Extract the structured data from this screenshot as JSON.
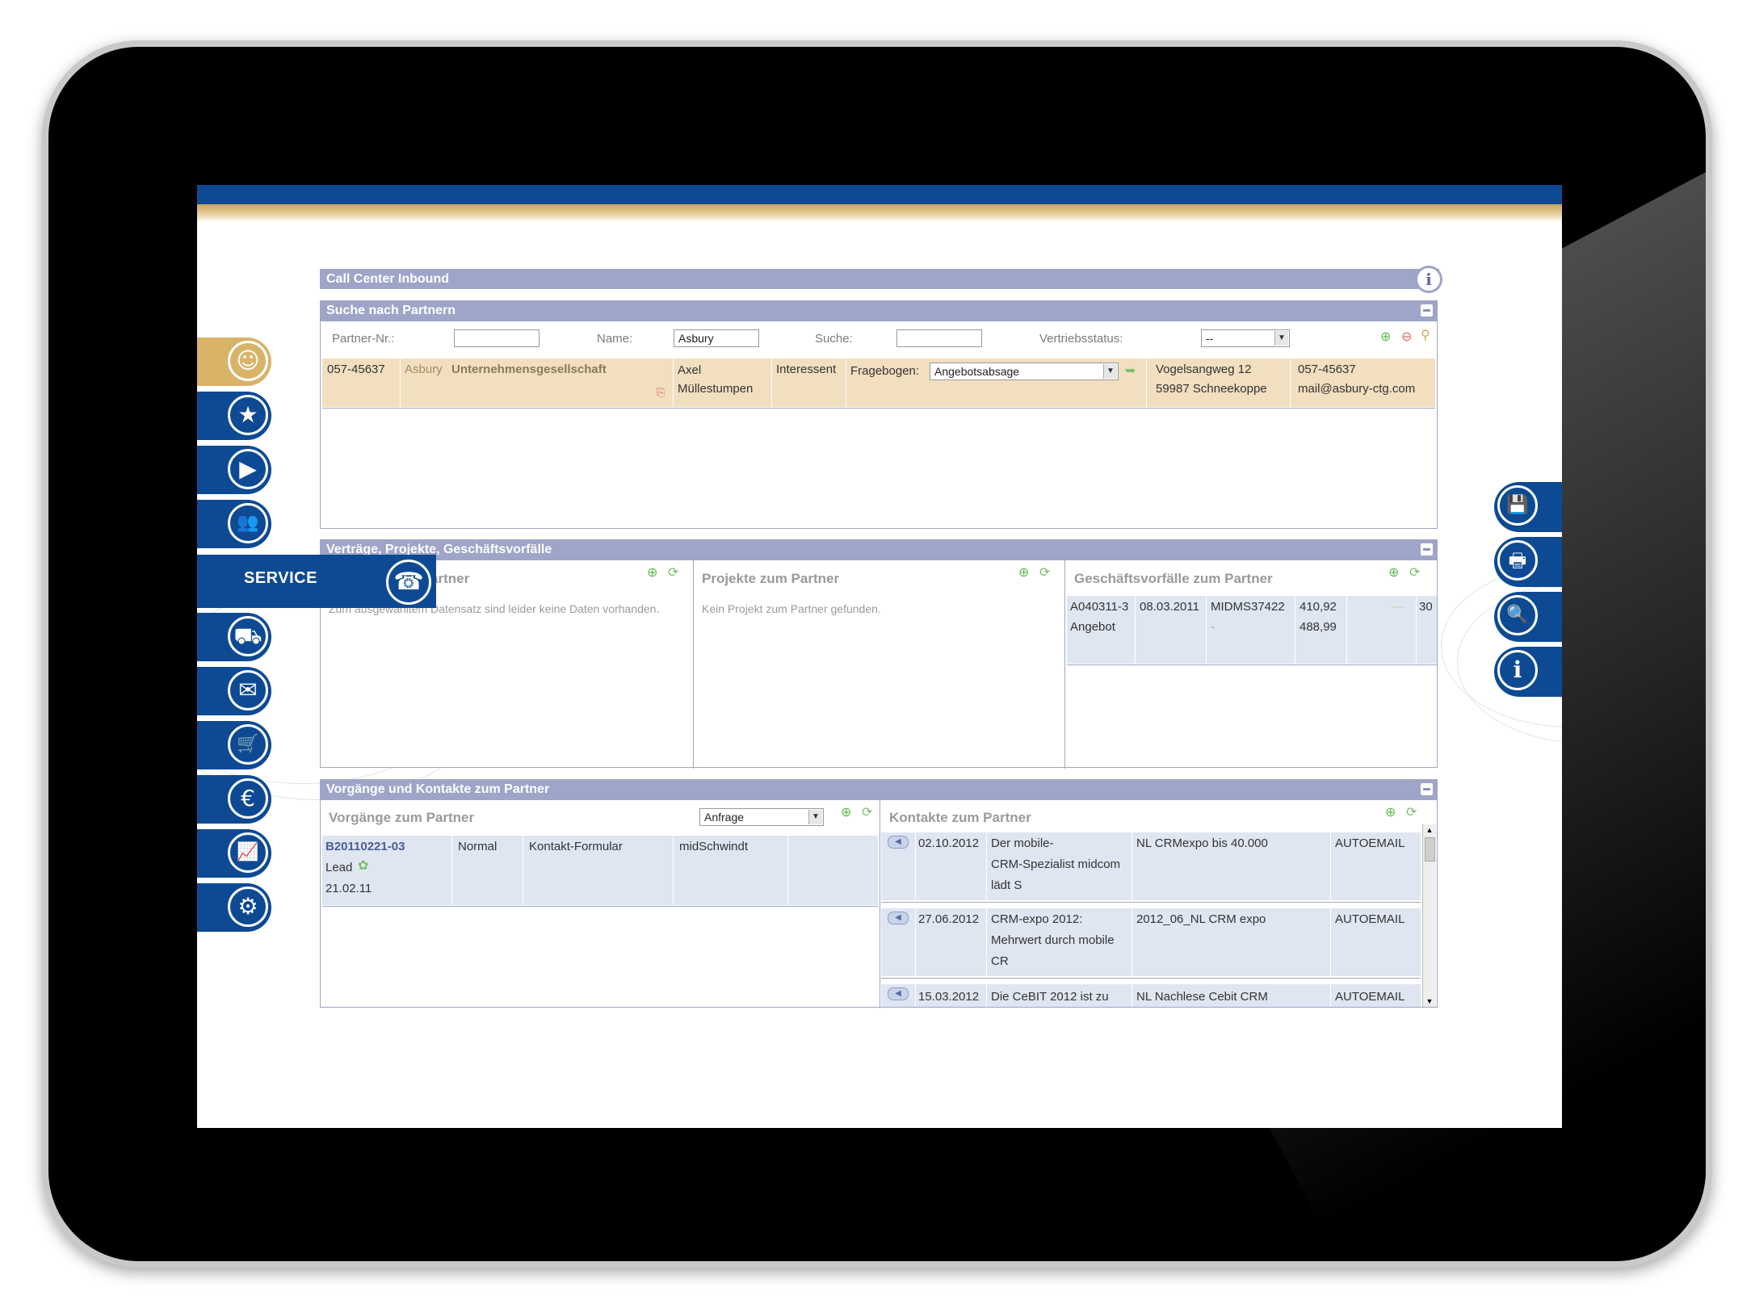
{
  "app": {
    "panel_title": "Call Center Inbound"
  },
  "colors": {
    "brand_blue": "#0d4a93",
    "gold": "#d9b368",
    "panel_header": "#9ea5c8",
    "result_row": "#f1dfc0",
    "list_row": "#dfe6f1"
  },
  "left_nav": {
    "items": [
      {
        "name": "partner",
        "icon": "user-icon",
        "glyph": "☺"
      },
      {
        "name": "favorites",
        "icon": "star-icon",
        "glyph": "★"
      },
      {
        "name": "media",
        "icon": "play-icon",
        "glyph": "▶"
      },
      {
        "name": "contacts",
        "icon": "people-icon",
        "glyph": "👥"
      },
      {
        "name": "logistics",
        "icon": "forklift-icon",
        "glyph": "⛟"
      },
      {
        "name": "mail",
        "icon": "envelope-icon",
        "glyph": "✉"
      },
      {
        "name": "shop",
        "icon": "cart-icon",
        "glyph": "🛒"
      },
      {
        "name": "finance",
        "icon": "euro-icon",
        "glyph": "€"
      },
      {
        "name": "reports",
        "icon": "chart-icon",
        "glyph": "📈"
      },
      {
        "name": "settings",
        "icon": "gears-icon",
        "glyph": "⚙"
      }
    ],
    "service_label": "SERVICE",
    "service_glyph": "☎"
  },
  "right_nav": {
    "items": [
      {
        "name": "save",
        "icon": "floppy-icon",
        "glyph": "💾"
      },
      {
        "name": "print",
        "icon": "printer-icon",
        "glyph": "🖶"
      },
      {
        "name": "search",
        "icon": "magnifier-icon",
        "glyph": "🔍"
      },
      {
        "name": "info",
        "icon": "info-icon",
        "glyph": "i"
      }
    ]
  },
  "search": {
    "title": "Suche nach Partnern",
    "partner_nr_label": "Partner-Nr.:",
    "partner_nr_value": "",
    "name_label": "Name:",
    "name_value": "Asbury",
    "suche_label": "Suche:",
    "suche_value": "",
    "status_label": "Vertriebsstatus:",
    "status_value": "--",
    "result": {
      "nr": "057-45637",
      "short": "Asbury",
      "company": "Unternehmensgesellschaft",
      "contact_first": "Axel",
      "contact_last": "Müllestumpen",
      "status": "Interessent",
      "fragebogen_label": "Fragebogen:",
      "fragebogen_value": "Angebotsabsage",
      "street": "Vogelsangweg 12",
      "city": "59987 Schneekoppe",
      "phone": "057-45637",
      "email": "mail@asbury-ctg.com"
    }
  },
  "vertraege": {
    "title": "Verträge, Projekte, Geschäftsvorfälle",
    "left_head": "artner",
    "left_empty": "Zum ausgewähltem Datensatz sind leider keine Daten vorhanden.",
    "mid_head": "Projekte zum Partner",
    "mid_empty": "Kein Projekt zum Partner gefunden.",
    "right_head": "Geschäftsvorfälle zum Partner",
    "row": {
      "id": "A040311-3",
      "type": "Angebot",
      "date": "08.03.2011",
      "ref": "MIDMS37422",
      "ref2": "-",
      "amt1": "410,92",
      "amt2": "488,99",
      "dash": "—",
      "num": "30"
    }
  },
  "vorgaenge": {
    "title": "Vorgänge und Kontakte zum Partner",
    "left_head": "Vorgänge zum Partner",
    "filter_value": "Anfrage",
    "row": {
      "id": "B20110221-03",
      "type": "Lead",
      "date": "21.02.11",
      "prio": "Normal",
      "channel": "Kontakt-Formular",
      "user": "midSchwindt"
    },
    "right_head": "Kontakte zum Partner",
    "contacts": [
      {
        "date": "02.10.2012",
        "subject_1": "Der mobile-",
        "subject_2": "CRM-Spezialist midcom",
        "subject_3": "lädt S",
        "campaign": "NL CRMexpo bis 40.000",
        "type": "AUTOEMAIL"
      },
      {
        "date": "27.06.2012",
        "subject_1": "CRM-expo 2012:",
        "subject_2": "Mehrwert durch mobile",
        "subject_3": "CR",
        "campaign": "2012_06_NL CRM expo",
        "type": "AUTOEMAIL"
      },
      {
        "date": "15.03.2012",
        "subject_1": "Die CeBIT 2012 ist zu",
        "subject_2": "",
        "subject_3": "",
        "campaign": "NL Nachlese Cebit CRM",
        "type": "AUTOEMAIL"
      }
    ]
  }
}
